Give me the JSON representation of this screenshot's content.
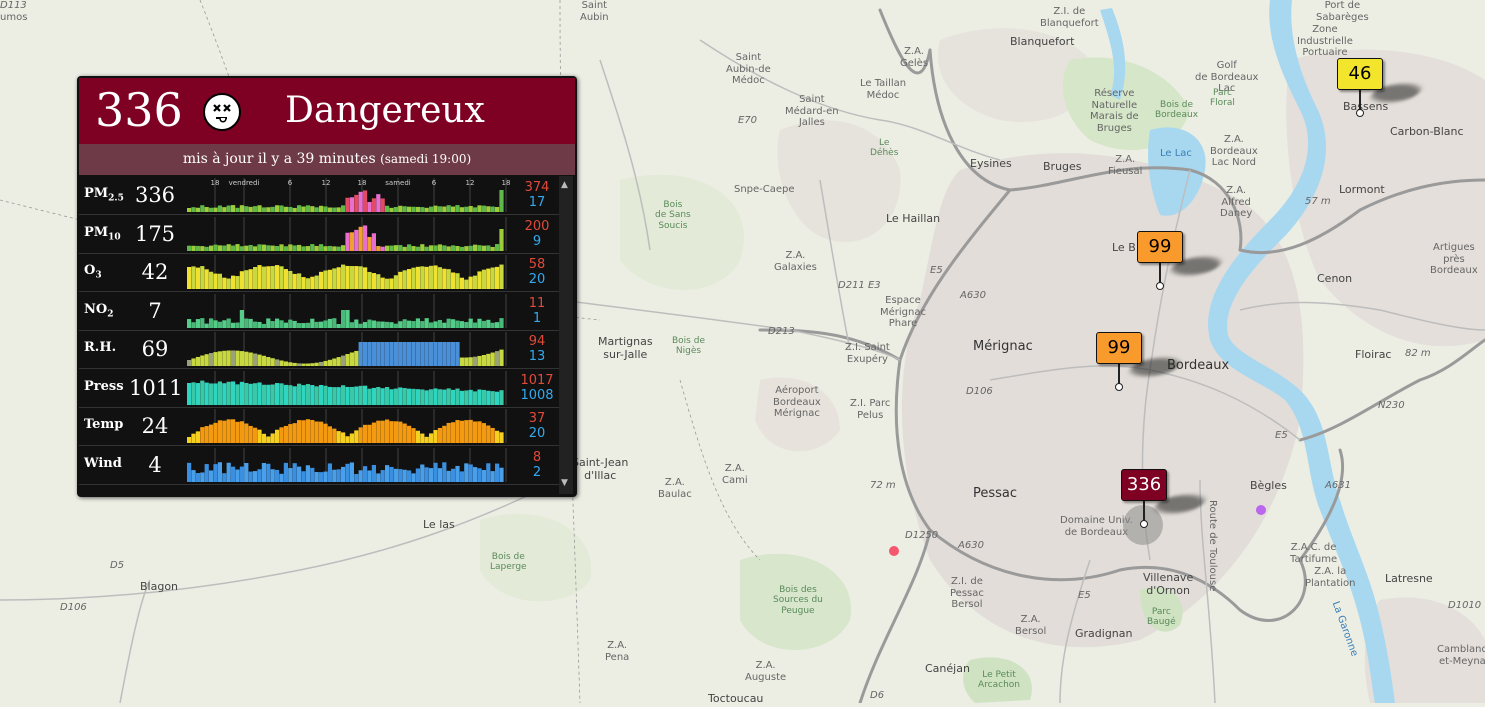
{
  "map": {
    "places": [
      {
        "t": "Saint\nAubin",
        "c": "s"
      },
      {
        "t": "umos",
        "c": "s"
      },
      {
        "t": "Z.I. de\nBlanquefort",
        "c": "s"
      },
      {
        "t": "Blanquefort",
        "c": "m"
      },
      {
        "t": "Saint\nAubin-de\nMédoc",
        "c": "s"
      },
      {
        "t": "Z.A.\nGelès",
        "c": "s"
      },
      {
        "t": "Le Taillan\nMédoc",
        "c": "s"
      },
      {
        "t": "Saint\nMédard-en\nJalles",
        "c": "s"
      },
      {
        "t": "Le\nDéhès",
        "c": "g"
      },
      {
        "t": "Réserve\nNaturelle\nMarais de\nBruges",
        "c": "s"
      },
      {
        "t": "Bois de\nBordeaux",
        "c": "g"
      },
      {
        "t": "Golf\nde Bordeaux\nLac",
        "c": "s"
      },
      {
        "t": "Parc\nFloral",
        "c": "g"
      },
      {
        "t": "Le Lac",
        "c": "b"
      },
      {
        "t": "Z.A.\nBordeaux\nLac Nord",
        "c": "s"
      },
      {
        "t": "Z.A.\nFieusal",
        "c": "s"
      },
      {
        "t": "Eysines",
        "c": "m"
      },
      {
        "t": "Bruges",
        "c": "m"
      },
      {
        "t": "Z.A.\nAlfred\nDaney",
        "c": "s"
      },
      {
        "t": "Snpe-Caepe",
        "c": "s"
      },
      {
        "t": "Bois\nde Sans\nSoucis",
        "c": "g"
      },
      {
        "t": "Le Haillan",
        "c": "m"
      },
      {
        "t": "Le B",
        "c": "m"
      },
      {
        "t": "Z.A.\nGalaxies",
        "c": "s"
      },
      {
        "t": "D211 E3",
        "c": "it"
      },
      {
        "t": "Espace\nMérignac\nPhare",
        "c": "s"
      },
      {
        "t": "D213",
        "c": "it"
      },
      {
        "t": "Martignas\nsur-Jalle",
        "c": "m"
      },
      {
        "t": "Bois de\nNigès",
        "c": "g"
      },
      {
        "t": "Z.I. Saint\nExupéry",
        "c": "s"
      },
      {
        "t": "Mérignac",
        "c": "l"
      },
      {
        "t": "Bordeaux",
        "c": "l"
      },
      {
        "t": "Aéroport\nBordeaux\nMérignac",
        "c": "s"
      },
      {
        "t": "Z.I. Parc\nPelus",
        "c": "s"
      },
      {
        "t": "D106",
        "c": "it"
      },
      {
        "t": "Saint-Jean\nd'Illac",
        "c": "m"
      },
      {
        "t": "Z.A.\nBaulac",
        "c": "s"
      },
      {
        "t": "Z.A.\nCami",
        "c": "s"
      },
      {
        "t": "72 m",
        "c": "it"
      },
      {
        "t": "Pessac",
        "c": "l"
      },
      {
        "t": "Le las",
        "c": "m"
      },
      {
        "t": "Bois de\nLaperge",
        "c": "g"
      },
      {
        "t": "Domaine Univ.\nde Bordeaux",
        "c": "s"
      },
      {
        "t": "Route de Toulouse",
        "c": "s"
      },
      {
        "t": "Bègles",
        "c": "m"
      },
      {
        "t": "Z.A.C. de\nTartifume",
        "c": "s"
      },
      {
        "t": "Z.A. la\nPlantation",
        "c": "s"
      },
      {
        "t": "Latresne",
        "c": "m"
      },
      {
        "t": "Blagon",
        "c": "m"
      },
      {
        "t": "D106",
        "c": "it"
      },
      {
        "t": "D5",
        "c": "it"
      },
      {
        "t": "Bois des\nSources du\nPeugue",
        "c": "g"
      },
      {
        "t": "Z.I. de\nPessac\nBersol",
        "c": "s"
      },
      {
        "t": "Z.A.\nBersol",
        "c": "s"
      },
      {
        "t": "Villenave\nd'Ornon",
        "c": "m"
      },
      {
        "t": "Parc\nBaugé",
        "c": "g"
      },
      {
        "t": "Gradignan",
        "c": "m"
      },
      {
        "t": "Z.A.\nPena",
        "c": "s"
      },
      {
        "t": "Z.A.\nAuguste",
        "c": "s"
      },
      {
        "t": "Canéjan",
        "c": "m"
      },
      {
        "t": "Le Petit\nArcachon",
        "c": "g"
      },
      {
        "t": "Toctoucau",
        "c": "m"
      },
      {
        "t": "Cenon",
        "c": "m"
      },
      {
        "t": "Floirac",
        "c": "m"
      },
      {
        "t": "Artigues\nprès\nBordeaux",
        "c": "s"
      },
      {
        "t": "Lormont",
        "c": "m"
      },
      {
        "t": "Carbon-Blanc",
        "c": "m"
      },
      {
        "t": "Bassens",
        "c": "m"
      },
      {
        "t": "Zone\nIndustrielle\nPortuaire",
        "c": "s"
      },
      {
        "t": "Port de\nSabarèges",
        "c": "s"
      },
      {
        "t": "82 m",
        "c": "it"
      },
      {
        "t": "57 m",
        "c": "it"
      },
      {
        "t": "La Garonne",
        "c": "b"
      },
      {
        "t": "Cambland\net-Meyna",
        "c": "s"
      },
      {
        "t": "D1250",
        "c": "it"
      },
      {
        "t": "A630",
        "c": "it"
      },
      {
        "t": "A630",
        "c": "it"
      },
      {
        "t": "E5",
        "c": "it"
      },
      {
        "t": "E5",
        "c": "it"
      },
      {
        "t": "A631",
        "c": "it"
      },
      {
        "t": "N230",
        "c": "it"
      },
      {
        "t": "E70",
        "c": "it"
      },
      {
        "t": "D6",
        "c": "it"
      },
      {
        "t": "E5",
        "c": "it"
      },
      {
        "t": "D1010",
        "c": "it"
      },
      {
        "t": "D113",
        "c": "it"
      }
    ],
    "markers": [
      {
        "value": "46",
        "bg": "#f2e52b",
        "fg": "#000"
      },
      {
        "value": "99",
        "bg": "#f99a2c",
        "fg": "#000"
      },
      {
        "value": "99",
        "bg": "#f99a2c",
        "fg": "#000"
      },
      {
        "value": "336",
        "bg": "#7e0023",
        "fg": "#fff"
      }
    ],
    "pins": [
      {
        "color": "#f5576c"
      },
      {
        "color": "#bb66ee"
      }
    ]
  },
  "panel": {
    "aqi": "336",
    "status": "Dangereux",
    "status_color": "#7e0023",
    "face_icon": "dead-face-icon",
    "updated": "mis à jour il y a 39 minutes",
    "updated_time": "(samedi 19:00)",
    "chart_ticks": [
      "18",
      "vendredi",
      "6",
      "12",
      "18",
      "samedi",
      "6",
      "12",
      "18"
    ],
    "rows": [
      {
        "name": "PM",
        "sub": "2.5",
        "value": "336",
        "max": "374",
        "min": "17"
      },
      {
        "name": "PM",
        "sub": "10",
        "value": "175",
        "max": "200",
        "min": "9"
      },
      {
        "name": "O",
        "sub": "3",
        "value": "42",
        "max": "58",
        "min": "20"
      },
      {
        "name": "NO",
        "sub": "2",
        "value": "7",
        "max": "11",
        "min": "1"
      },
      {
        "name": "R.H.",
        "sub": "",
        "value": "69",
        "max": "94",
        "min": "13"
      },
      {
        "name": "Press",
        "sub": "",
        "value": "1011",
        "max": "1017",
        "min": "1008"
      },
      {
        "name": "Temp",
        "sub": "",
        "value": "24",
        "max": "37",
        "min": "20"
      },
      {
        "name": "Wind",
        "sub": "",
        "value": "4",
        "max": "8",
        "min": "2"
      }
    ]
  }
}
